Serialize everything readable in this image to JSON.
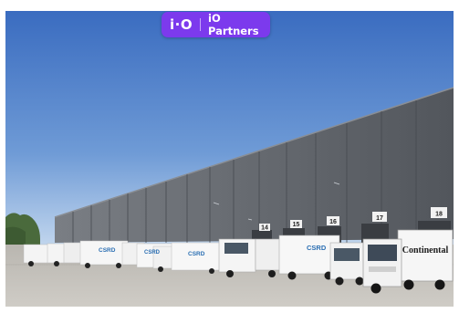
{
  "badge": {
    "logo_text": "i·O",
    "brand_text": "iO Partners",
    "color": "#7c3aed"
  },
  "scene": {
    "dock_numbers": [
      "14",
      "15",
      "16",
      "17",
      "18"
    ],
    "truck_branding": [
      "CSRD",
      "CSRD",
      "CSRD",
      "CSRD",
      "Continental"
    ]
  },
  "colors": {
    "sky_top": "#3d6fc0",
    "sky_bottom": "#bcd3ec",
    "building": "#5f6369",
    "ground": "#c4c1bc"
  }
}
